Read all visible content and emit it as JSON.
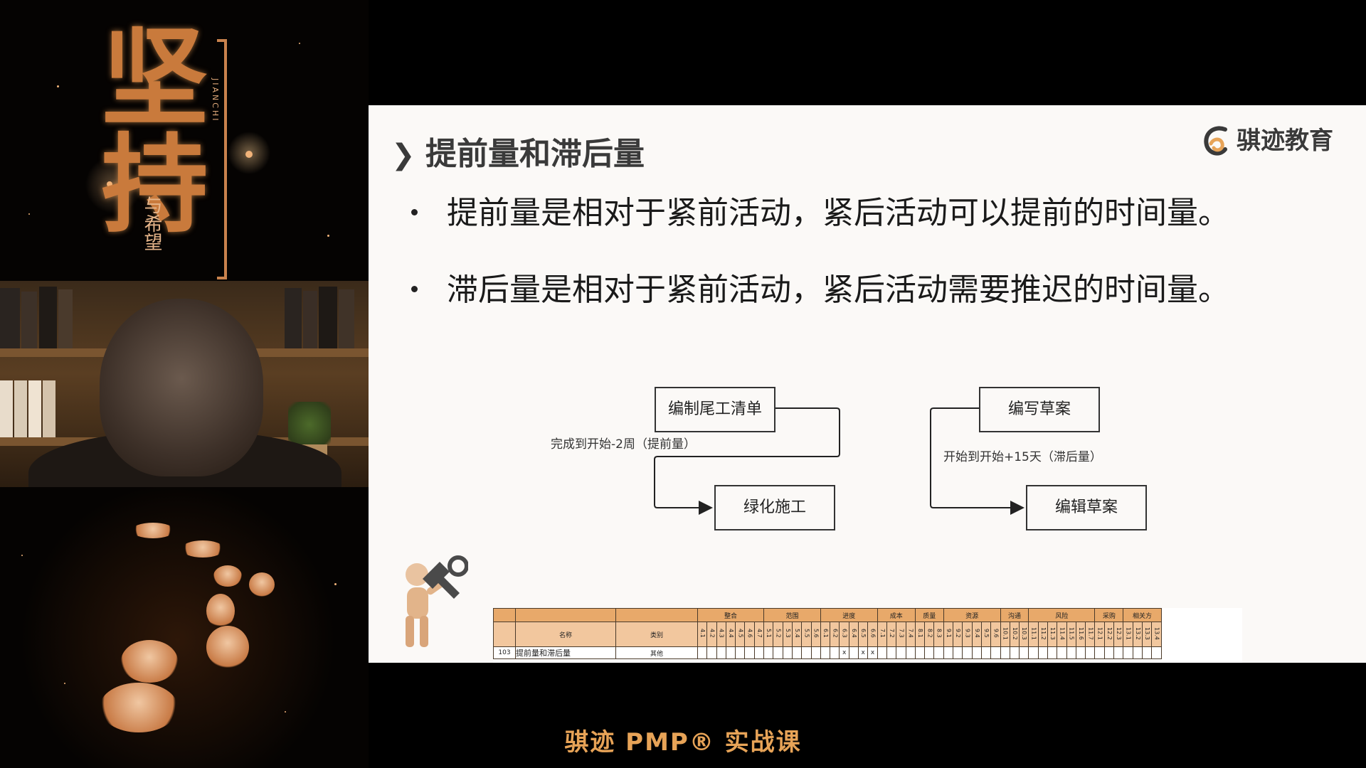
{
  "poster": {
    "calligraphy": "坚持",
    "subtitle": "与希望",
    "pinyin": "JIANCHI"
  },
  "slide": {
    "title": "提前量和滞后量",
    "brand": "骐迹教育",
    "bullets": [
      "提前量是相对于紧前活动，紧后活动可以提前的时间量。",
      "滞后量是相对于紧前活动，紧后活动需要推迟的时间量。"
    ],
    "diagram": {
      "lead": {
        "from": "编制尾工清单",
        "to": "绿化施工",
        "relation": "完成到开始-2周（提前量）"
      },
      "lag": {
        "from": "编写草案",
        "to": "编辑草案",
        "relation": "开始到开始+15天（滞后量）"
      }
    },
    "sheet": {
      "name_header": "名称",
      "type_header": "类别",
      "groups": [
        {
          "name": "整合",
          "codes": [
            "4.1",
            "4.2",
            "4.3",
            "4.4",
            "4.5",
            "4.6",
            "4.7"
          ]
        },
        {
          "name": "范围",
          "codes": [
            "5.1",
            "5.2",
            "5.3",
            "5.4",
            "5.5",
            "5.6"
          ]
        },
        {
          "name": "进度",
          "codes": [
            "6.1",
            "6.2",
            "6.3",
            "6.4",
            "6.5",
            "6.6"
          ]
        },
        {
          "name": "成本",
          "codes": [
            "7.1",
            "7.2",
            "7.3",
            "7.4"
          ]
        },
        {
          "name": "质量",
          "codes": [
            "8.1",
            "8.2",
            "8.3"
          ]
        },
        {
          "name": "资源",
          "codes": [
            "9.1",
            "9.2",
            "9.3",
            "9.4",
            "9.5",
            "9.6"
          ]
        },
        {
          "name": "沟通",
          "codes": [
            "10.1",
            "10.2",
            "10.3"
          ]
        },
        {
          "name": "风险",
          "codes": [
            "11.1",
            "11.2",
            "11.3",
            "11.4",
            "11.5",
            "11.6",
            "11.7"
          ]
        },
        {
          "name": "采购",
          "codes": [
            "12.1",
            "12.2",
            "12.3"
          ]
        },
        {
          "name": "相关方",
          "codes": [
            "13.1",
            "13.2",
            "13.3",
            "13.4"
          ]
        }
      ],
      "row": {
        "index": "103",
        "name": "提前量和滞后量",
        "type": "其他",
        "marks": {
          "6.3": "x",
          "6.5": "x",
          "6.6": "x"
        }
      }
    }
  },
  "footer": {
    "course_title": "骐迹 PMP® 实战课"
  },
  "colors": {
    "accent_orange": "#e7a357",
    "sheet_header": "#e8a96a",
    "slide_bg": "#fbf9f7"
  }
}
